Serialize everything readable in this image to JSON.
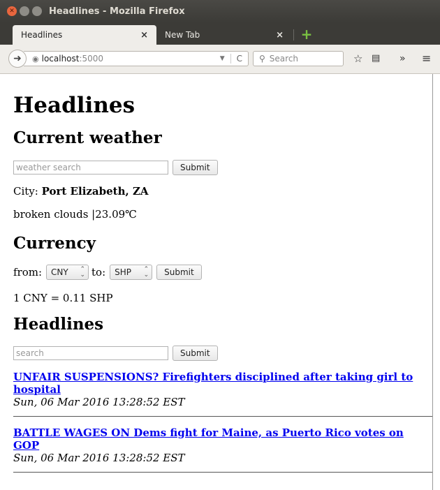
{
  "window": {
    "title": "Headlines - Mozilla Firefox"
  },
  "tabs": [
    {
      "label": "Headlines",
      "active": true
    },
    {
      "label": "New Tab",
      "active": false
    }
  ],
  "navbar": {
    "url_host": "localhost",
    "url_port": ":5000",
    "search_placeholder": "Search"
  },
  "icons": {
    "close": "×",
    "back": "arrow-left",
    "new_tab": "plus"
  },
  "page": {
    "title": "Headlines",
    "weather": {
      "heading": "Current weather",
      "search_placeholder": "weather search",
      "submit_label": "Submit",
      "city_label": "City:",
      "city_value": "Port Elizabeth, ZA",
      "description": "broken clouds |23.09℃"
    },
    "currency": {
      "heading": "Currency",
      "from_label": "from:",
      "from_value": "CNY",
      "to_label": "to:",
      "to_value": "SHP",
      "submit_label": "Submit",
      "rate_text": "1 CNY = 0.11 SHP"
    },
    "headlines": {
      "heading": "Headlines",
      "search_placeholder": "search",
      "submit_label": "Submit",
      "articles": [
        {
          "title": "UNFAIR SUSPENSIONS? Firefighters disciplined after taking girl to hospital",
          "date": "Sun, 06 Mar 2016 13:28:52 EST"
        },
        {
          "title": "BATTLE WAGES ON Dems fight for Maine, as Puerto Rico votes on GOP",
          "date": "Sun, 06 Mar 2016 13:28:52 EST"
        }
      ]
    }
  },
  "colors": {
    "link": "#0000ee",
    "titlebar": "#3c3b37",
    "close_button": "#e9663e",
    "new_tab_plus": "#7ac142"
  }
}
